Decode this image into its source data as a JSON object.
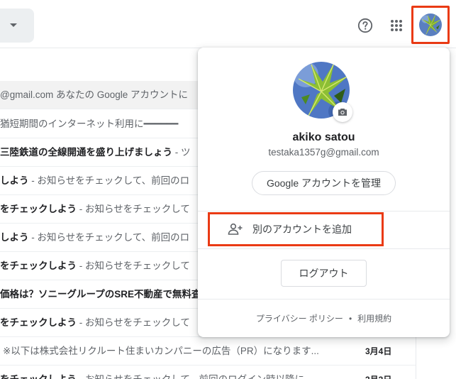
{
  "topbar": {
    "search_dropdown_icon": "caret-down-icon",
    "help_icon": "help-circle-icon",
    "apps_icon": "apps-grid-icon",
    "account_icon": "avatar"
  },
  "mail_list": [
    {
      "subject": "",
      "snippet": "@gmail.com あなたの Google アカウントに",
      "date": "",
      "highlight": true
    },
    {
      "subject": "",
      "snippet": "猶短期間のインターネット利用に━━━━━━",
      "date": "",
      "highlight": false
    },
    {
      "subject": "三陸鉄道の全線開通を盛り上げましょう",
      "snippet": " - ツ",
      "date": "",
      "highlight": false
    },
    {
      "subject": "しよう",
      "snippet": " - お知らせをチェックして、前回のロ",
      "date": "",
      "highlight": false
    },
    {
      "subject": "をチェックしよう",
      "snippet": " - お知らせをチェックして",
      "date": "",
      "highlight": false
    },
    {
      "subject": "しよう",
      "snippet": " - お知らせをチェックして、前回のロ",
      "date": "",
      "highlight": false
    },
    {
      "subject": "をチェックしよう",
      "snippet": " - お知らせをチェックして",
      "date": "",
      "highlight": false
    },
    {
      "subject": "価格は？ソニーグループのSRE不動産で無料査",
      "snippet": "",
      "date": "",
      "highlight": false
    },
    {
      "subject": "をチェックしよう",
      "snippet": " - お知らせをチェックして",
      "date": "",
      "highlight": false
    },
    {
      "subject": "",
      "snippet": "※以下は株式会社リクルート住まいカンパニーの広告（PR）になります...",
      "date": "3月4日",
      "highlight": false
    },
    {
      "subject": "をチェックしよう",
      "snippet": " - お知らせをチェックして、前回のログイン時以降に",
      "date": "3月3日",
      "highlight": false
    }
  ],
  "account_popup": {
    "name": "akiko satou",
    "email": "testaka1357g@gmail.com",
    "manage_button": "Google アカウントを管理",
    "add_account": "別のアカウントを追加",
    "logout": "ログアウト",
    "privacy": "プライバシー ポリシー",
    "separator": "•",
    "terms": "利用規約"
  },
  "colors": {
    "highlight_border": "#ea3a14",
    "text_primary": "#202124",
    "text_secondary": "#5f6368"
  }
}
